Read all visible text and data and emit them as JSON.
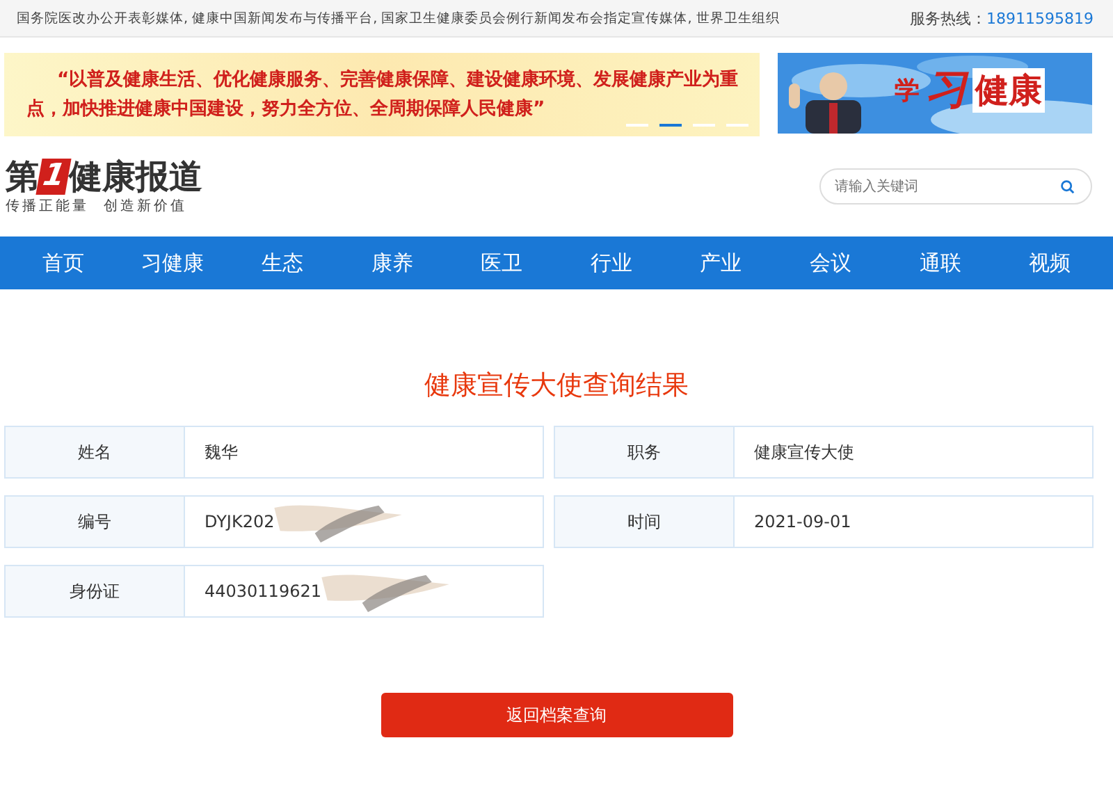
{
  "top_bar": {
    "tagline": "国务院医改办公开表彰媒体, 健康中国新闻发布与传播平台, 国家卫生健康委员会例行新闻发布会指定宣传媒体, 世界卫生组织",
    "hotline_label": "服务热线：",
    "hotline": "18911595819"
  },
  "banner": {
    "slogan": "“以普及健康生活、优化健康服务、完善健康保障、建设健康环境、发展健康产业为重点，加快推进健康中国建设，努力全方位、全周期保障人民健康”",
    "indicators": [
      {
        "selected": false
      },
      {
        "selected": true
      },
      {
        "selected": false
      },
      {
        "selected": false
      }
    ]
  },
  "side_banner": {
    "words": [
      "学",
      "习",
      "健康"
    ]
  },
  "logo": {
    "prefix": "第",
    "number": "1",
    "name": "健康报道",
    "subtitle": "传播正能量  创造新价值"
  },
  "search": {
    "placeholder": "请输入关键词"
  },
  "nav": [
    {
      "label": "首页"
    },
    {
      "label": "习健康"
    },
    {
      "label": "生态"
    },
    {
      "label": "康养"
    },
    {
      "label": "医卫"
    },
    {
      "label": "行业"
    },
    {
      "label": "产业"
    },
    {
      "label": "会议"
    },
    {
      "label": "通联"
    },
    {
      "label": "视频"
    }
  ],
  "title": "健康宣传大使查询结果",
  "fields": [
    {
      "label": "姓名",
      "value": "魏华",
      "redacted": false
    },
    {
      "label": "职务",
      "value": "健康宣传大使",
      "redacted": false
    },
    {
      "label": "编号",
      "value": "DYJK202",
      "redacted": true
    },
    {
      "label": "时间",
      "value": "2021-09-01",
      "redacted": false
    },
    {
      "label": "身份证",
      "value": "44030119621",
      "redacted": true
    }
  ],
  "back_button": "返回档案查询"
}
